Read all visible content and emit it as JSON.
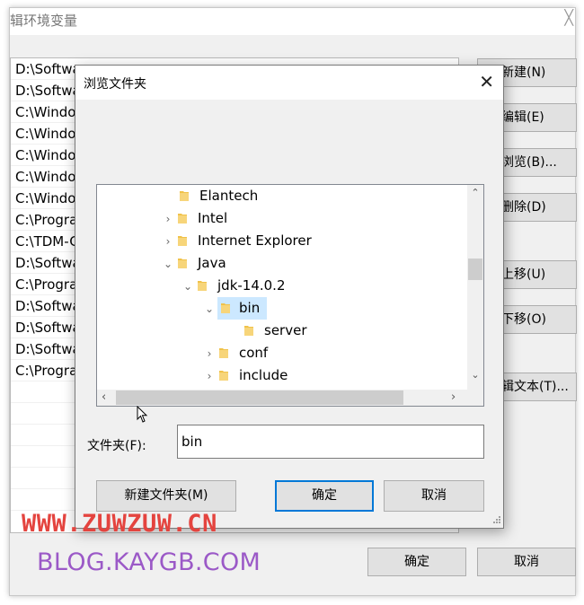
{
  "background_dialog": {
    "title": "辑环境变量",
    "close_glyph": "╳",
    "rows": [
      "D:\\Softwa",
      "D:\\Softwa",
      "C:\\Windo",
      "C:\\Windo",
      "C:\\Windo",
      "C:\\Windo",
      "C:\\Windo",
      "C:\\Progra",
      "C:\\TDM-G",
      "D:\\Softwa",
      "C:\\Progra",
      "D:\\Softwa",
      "D:\\Softwa",
      "D:\\Softwa",
      "C:\\Progra"
    ],
    "buttons": {
      "new": "新建(N)",
      "edit": "编辑(E)",
      "browse": "浏览(B)...",
      "delete": "删除(D)",
      "move_up": "上移(U)",
      "move_down": "下移(O)",
      "edit_text": "辑文本(T)..."
    },
    "ok": "确定",
    "cancel": "取消"
  },
  "browse_dialog": {
    "title": "浏览文件夹",
    "close_glyph": "✕",
    "tree": [
      {
        "label": "Elantech",
        "chevron": ""
      },
      {
        "label": "Intel",
        "chevron": "›"
      },
      {
        "label": "Internet Explorer",
        "chevron": "›"
      },
      {
        "label": "Java",
        "chevron": "⌄"
      },
      {
        "label": "jdk-14.0.2",
        "chevron": "⌄"
      },
      {
        "label": "bin",
        "chevron": "⌄"
      },
      {
        "label": "server",
        "chevron": ""
      },
      {
        "label": "conf",
        "chevron": "›"
      },
      {
        "label": "include",
        "chevron": "›"
      }
    ],
    "selected_item": "bin",
    "folder_label": "文件夹(F):",
    "folder_value": "bin",
    "new_folder_button": "新建文件夹(M)",
    "ok_button": "确定",
    "cancel_button": "取消"
  },
  "watermark": {
    "line1": "WWW.ZUWZUW.CN",
    "line2": "BLOG.KAYGB.COM"
  },
  "colors": {
    "selection": "#cce8ff",
    "default_button_border": "#0078d7",
    "folder_icon": "#f0c24a",
    "watermark_line1": "#e4443f",
    "watermark_line2": "#9b59c7"
  }
}
